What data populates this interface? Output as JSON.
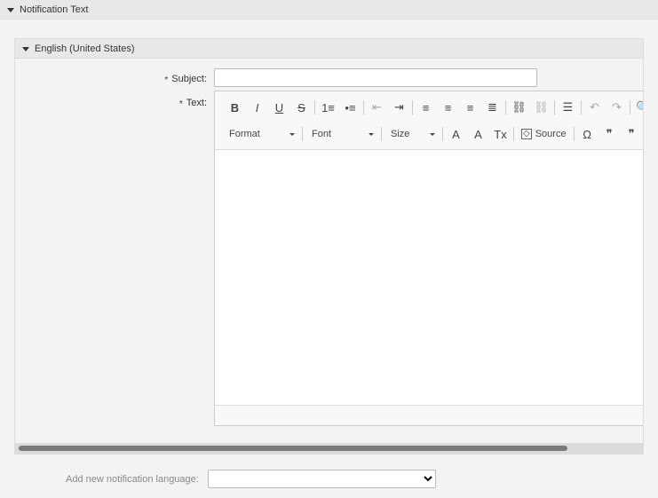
{
  "section": {
    "title": "Notification Text"
  },
  "language_panel": {
    "title": "English (United States)",
    "subject_label": "Subject:",
    "text_label": "Text:",
    "required_marker": "*",
    "subject_value": ""
  },
  "editor": {
    "toolbar_row1": [
      {
        "name": "bold-button",
        "glyph": "B",
        "dim": false
      },
      {
        "name": "italic-button",
        "glyph": "I",
        "dim": false
      },
      {
        "name": "underline-button",
        "glyph": "U",
        "dim": false
      },
      {
        "name": "strike-button",
        "glyph": "S",
        "dim": false
      },
      {
        "sep": true
      },
      {
        "name": "numbered-list-button",
        "glyph": "1≡",
        "dim": false
      },
      {
        "name": "bulleted-list-button",
        "glyph": "•≡",
        "dim": false
      },
      {
        "sep": true
      },
      {
        "name": "outdent-button",
        "glyph": "⇤",
        "dim": true
      },
      {
        "name": "indent-button",
        "glyph": "⇥",
        "dim": false
      },
      {
        "sep": true
      },
      {
        "name": "align-left-button",
        "glyph": "≡",
        "dim": false
      },
      {
        "name": "align-center-button",
        "glyph": "≡",
        "dim": false
      },
      {
        "name": "align-right-button",
        "glyph": "≡",
        "dim": false
      },
      {
        "name": "align-justify-button",
        "glyph": "≣",
        "dim": false
      },
      {
        "sep": true
      },
      {
        "name": "link-button",
        "glyph": "⛓",
        "dim": false
      },
      {
        "name": "unlink-button",
        "glyph": "⛓",
        "dim": true
      },
      {
        "sep": true
      },
      {
        "name": "horizontal-rule-button",
        "glyph": "☰",
        "dim": false
      },
      {
        "sep": true
      },
      {
        "name": "undo-button",
        "glyph": "↶",
        "dim": true
      },
      {
        "name": "redo-button",
        "glyph": "↷",
        "dim": true
      },
      {
        "sep": true
      },
      {
        "name": "find-button",
        "glyph": "🔍",
        "dim": false
      }
    ],
    "format_label": "Format",
    "font_label": "Font",
    "size_label": "Size",
    "source_label": "Source",
    "toolbar_row2_icons": [
      {
        "name": "text-color-icon",
        "glyph": "A"
      },
      {
        "name": "background-color-icon",
        "glyph": "A"
      },
      {
        "name": "remove-format-icon",
        "glyph": "Tx"
      }
    ],
    "toolbar_row2_tail": [
      {
        "name": "special-char-icon",
        "glyph": "Ω"
      },
      {
        "name": "blockquote-icon",
        "glyph": "❞"
      },
      {
        "name": "quote-icon",
        "glyph": "❞"
      }
    ]
  },
  "add_language": {
    "label": "Add new notification language:",
    "value": ""
  }
}
